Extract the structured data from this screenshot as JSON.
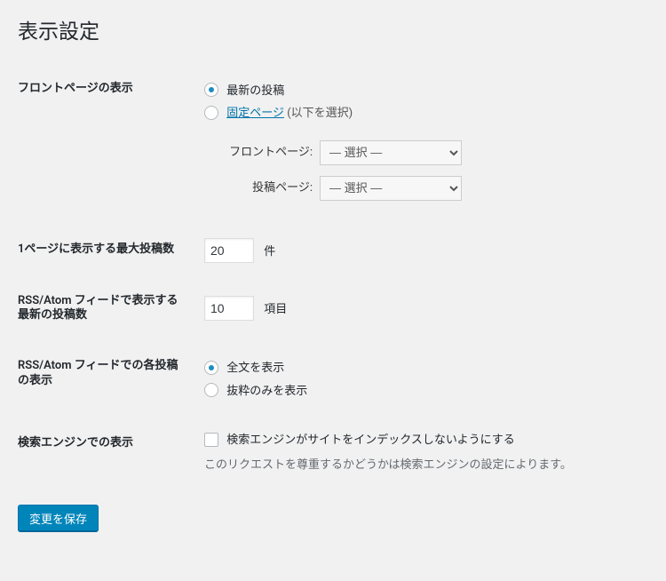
{
  "page": {
    "title": "表示設定"
  },
  "front_page": {
    "label": "フロントページの表示",
    "opt_latest": "最新の投稿",
    "opt_static_link": "固定ページ",
    "opt_static_suffix": " (以下を選択)",
    "front_label": "フロントページ:",
    "posts_label": "投稿ページ:",
    "select_placeholder": "— 選択 —"
  },
  "posts_per_page": {
    "label": "1ページに表示する最大投稿数",
    "value": "20",
    "unit": "件"
  },
  "rss_items": {
    "label": "RSS/Atom フィードで表示する最新の投稿数",
    "value": "10",
    "unit": "項目"
  },
  "rss_content": {
    "label": "RSS/Atom フィードでの各投稿の表示",
    "opt_full": "全文を表示",
    "opt_excerpt": "抜粋のみを表示"
  },
  "search_engine": {
    "label": "検索エンジンでの表示",
    "checkbox_label": "検索エンジンがサイトをインデックスしないようにする",
    "description": "このリクエストを尊重するかどうかは検索エンジンの設定によります。"
  },
  "submit": {
    "label": "変更を保存"
  }
}
